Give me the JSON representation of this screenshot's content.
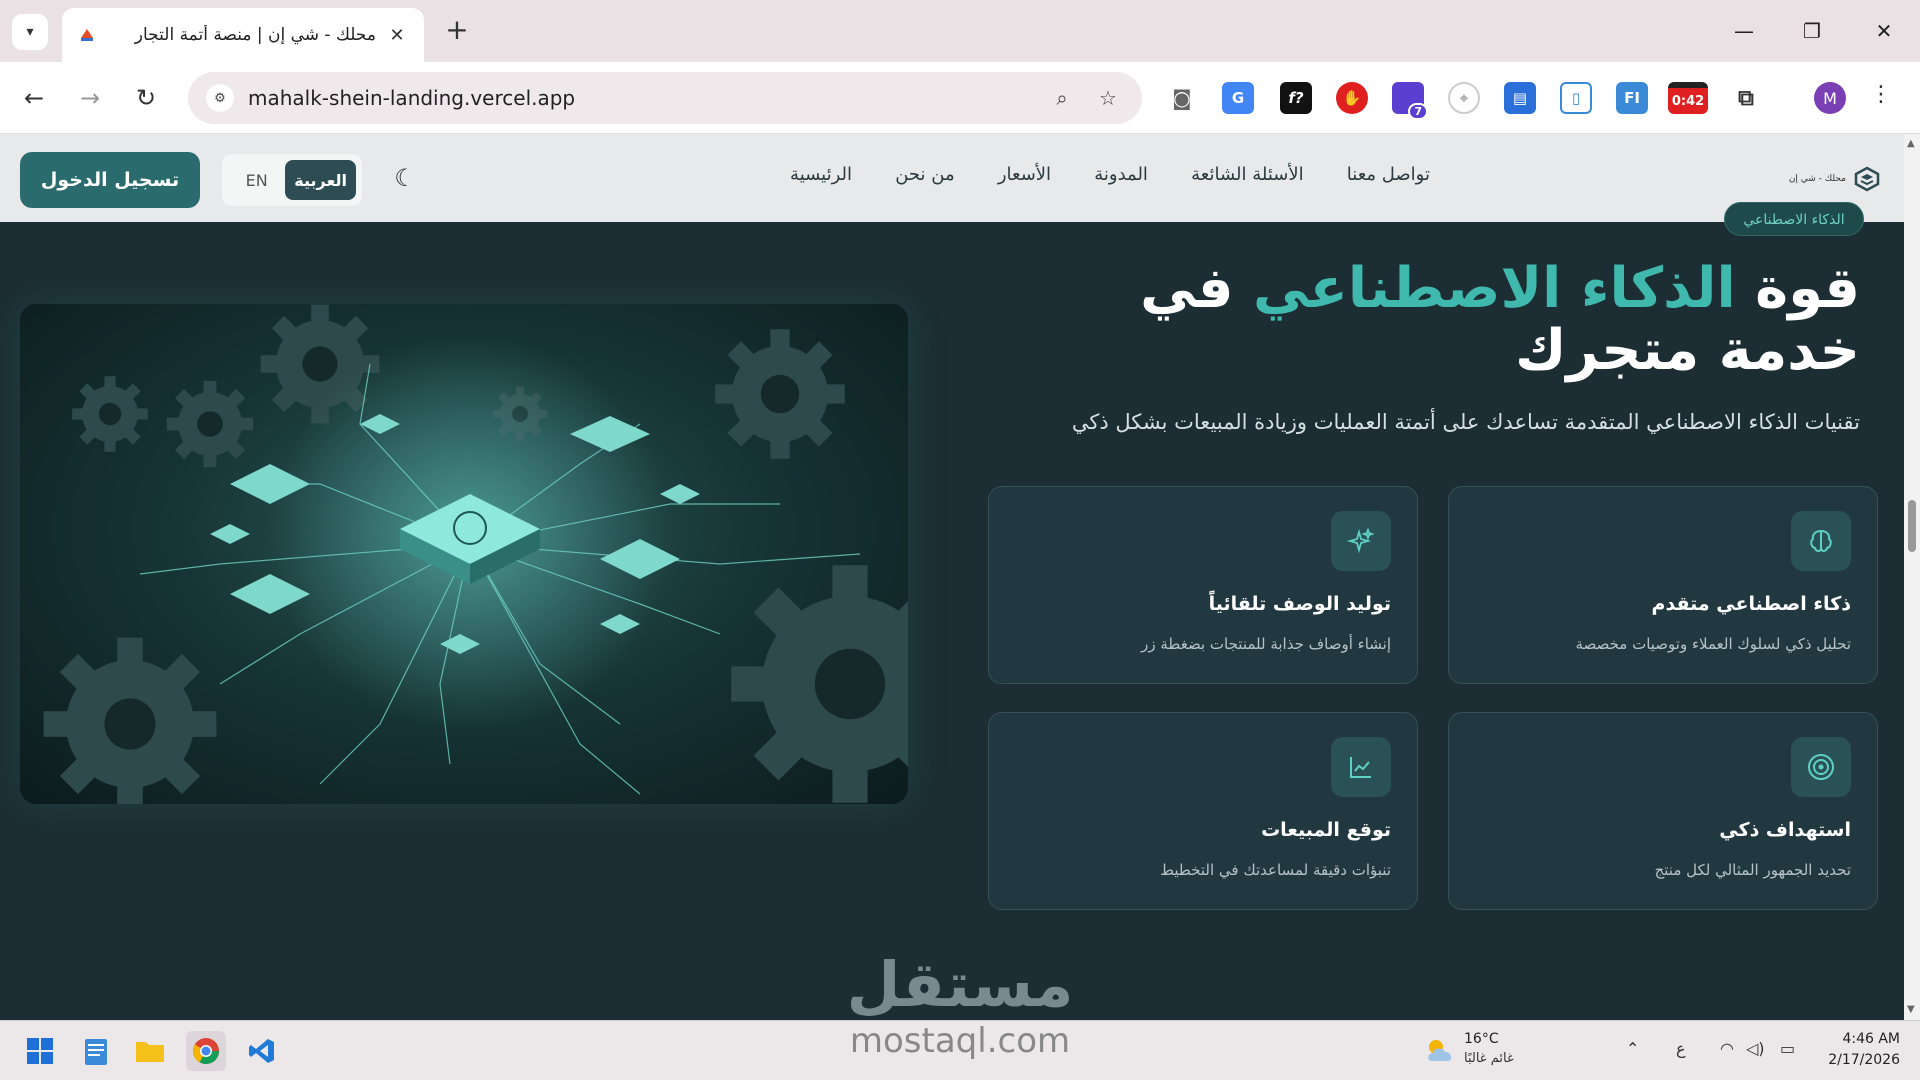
{
  "browser": {
    "tab_title": "محلك - شي إن | منصة أتمة التجار",
    "url": "mahalk-shein-landing.vercel.app",
    "extension_timer": "0:42",
    "extension_badge": "7",
    "profile_initial": "M"
  },
  "header": {
    "brand_text": "محلك - شي إن",
    "nav": [
      "الرئيسية",
      "من نحن",
      "الأسعار",
      "المدونة",
      "الأسئلة الشائعة",
      "تواصل معنا"
    ],
    "lang_ar": "العربية",
    "lang_en": "EN",
    "login_label": "تسجيل الدخول"
  },
  "hero": {
    "badge": "الذكاء الاصطناعي",
    "title_part1": "قوة",
    "title_accent": "الذكاء الاصطناعي",
    "title_part2": "في خدمة متجرك",
    "subtitle": "تقنيات الذكاء الاصطناعي المتقدمة تساعدك على أتمتة العمليات وزيادة المبيعات بشكل ذكي"
  },
  "features": [
    {
      "icon": "brain-icon",
      "title": "ذكاء اصطناعي متقدم",
      "desc": "تحليل ذكي لسلوك العملاء وتوصيات مخصصة"
    },
    {
      "icon": "sparkles-icon",
      "title": "توليد الوصف تلقائياً",
      "desc": "إنشاء أوصاف جذابة للمنتجات بضغطة زر"
    },
    {
      "icon": "target-icon",
      "title": "استهداف ذكي",
      "desc": "تحديد الجمهور المثالي لكل منتج"
    },
    {
      "icon": "chart-line-icon",
      "title": "توقع المبيعات",
      "desc": "تنبؤات دقيقة لمساعدتك في التخطيط"
    }
  ],
  "watermark": {
    "ar": "مستقل",
    "en": "mostaql.com"
  },
  "taskbar": {
    "temperature": "16°C",
    "weather": "غائم غالبًا",
    "lang_indicator": "ع",
    "time": "4:46 AM",
    "date": "2/17/2026"
  },
  "colors": {
    "accent": "#3fb8ad",
    "background": "#1c2d33",
    "card": "#223840",
    "login_button": "#2a6b6e"
  }
}
